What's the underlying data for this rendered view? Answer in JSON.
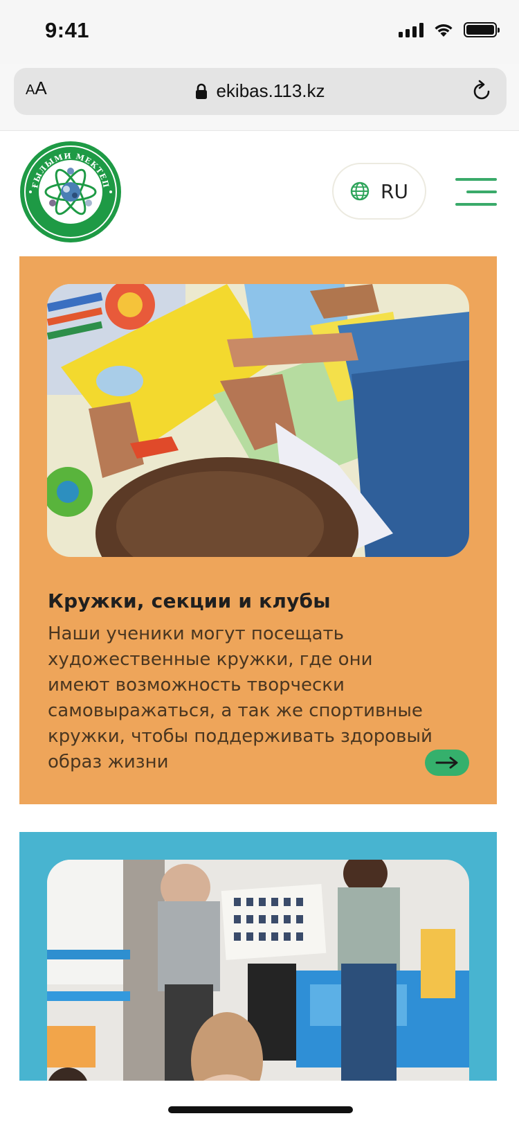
{
  "status_bar": {
    "time": "9:41",
    "icons": [
      "cellular-signal-icon",
      "wifi-icon",
      "battery-icon"
    ]
  },
  "browser": {
    "text_size_button": {
      "small": "A",
      "large": "A"
    },
    "url": "ekibas.113.kz",
    "icons": [
      "lock-icon",
      "reload-icon"
    ]
  },
  "header": {
    "logo_text": "ҒЫЛЫМИ МЕКТЕП",
    "language_label": "RU",
    "icons": [
      "globe-icon",
      "menu-icon"
    ]
  },
  "cards": [
    {
      "title": "Кружки, секции и клубы",
      "text": "Наши ученики могут посещать художественные кружки, где они имеют возможность творчески самовыражаться, а так же спортивные кружки, чтобы поддерживать здоровый образ жизни",
      "background": "#eea55a",
      "arrow_icon": "arrow-right-icon"
    },
    {
      "background": "#48b4d0"
    }
  ],
  "colors": {
    "accent_green": "#35b06c",
    "card_orange": "#eea55a",
    "card_blue": "#48b4d0"
  }
}
